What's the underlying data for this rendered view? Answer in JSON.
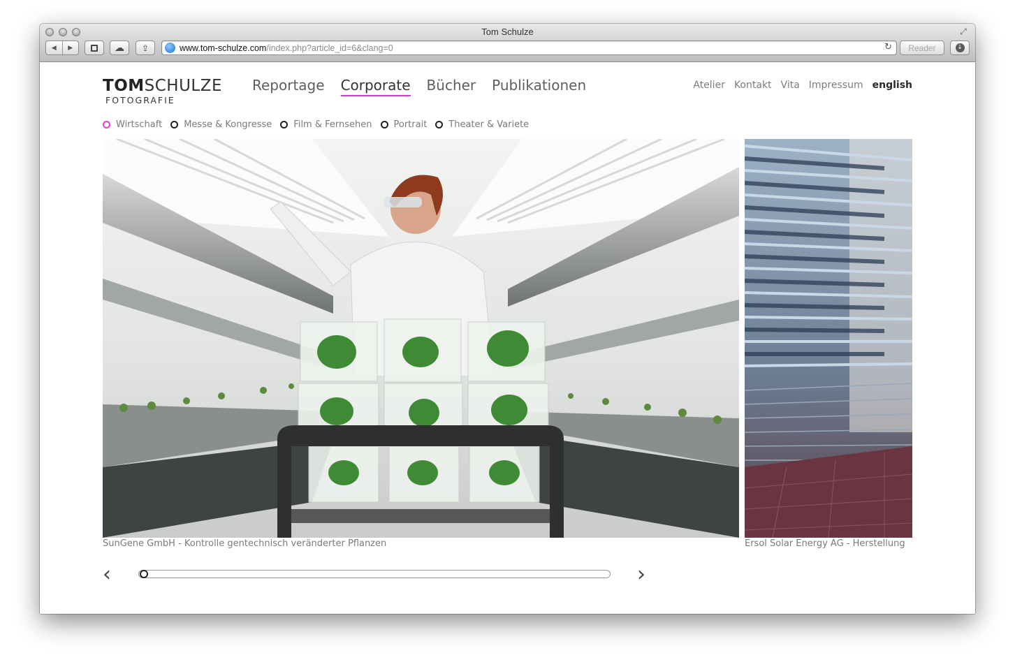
{
  "window": {
    "title": "Tom Schulze",
    "url_host": "www.tom-schulze.com",
    "url_path": "/index.php?article_id=6&clang=0",
    "reader_label": "Reader"
  },
  "site": {
    "logo_bold": "TOM",
    "logo_light": "SCHULZE",
    "logo_sub": "FOTOGRAFIE",
    "main_nav": [
      "Reportage",
      "Corporate",
      "Bücher",
      "Publikationen"
    ],
    "active_main": "Corporate",
    "meta_nav": [
      "Atelier",
      "Kontakt",
      "Vita",
      "Impressum"
    ],
    "lang_link": "english",
    "sub_nav": [
      "Wirtschaft",
      "Messe & Kongresse",
      "Film & Fernsehen",
      "Portrait",
      "Theater & Variete"
    ],
    "active_sub": "Wirtschaft"
  },
  "gallery": {
    "captions": [
      "SunGene GmbH - Kontrolle gentechnisch veränderter Pflanzen",
      "Ersol Solar Energy AG - Herstellung"
    ],
    "slider_position": 0,
    "prev_icon": "chevron-left-icon",
    "next_icon": "chevron-right-icon"
  },
  "colors": {
    "accent": "#d23cd0",
    "text_muted": "#7a7a7a"
  }
}
